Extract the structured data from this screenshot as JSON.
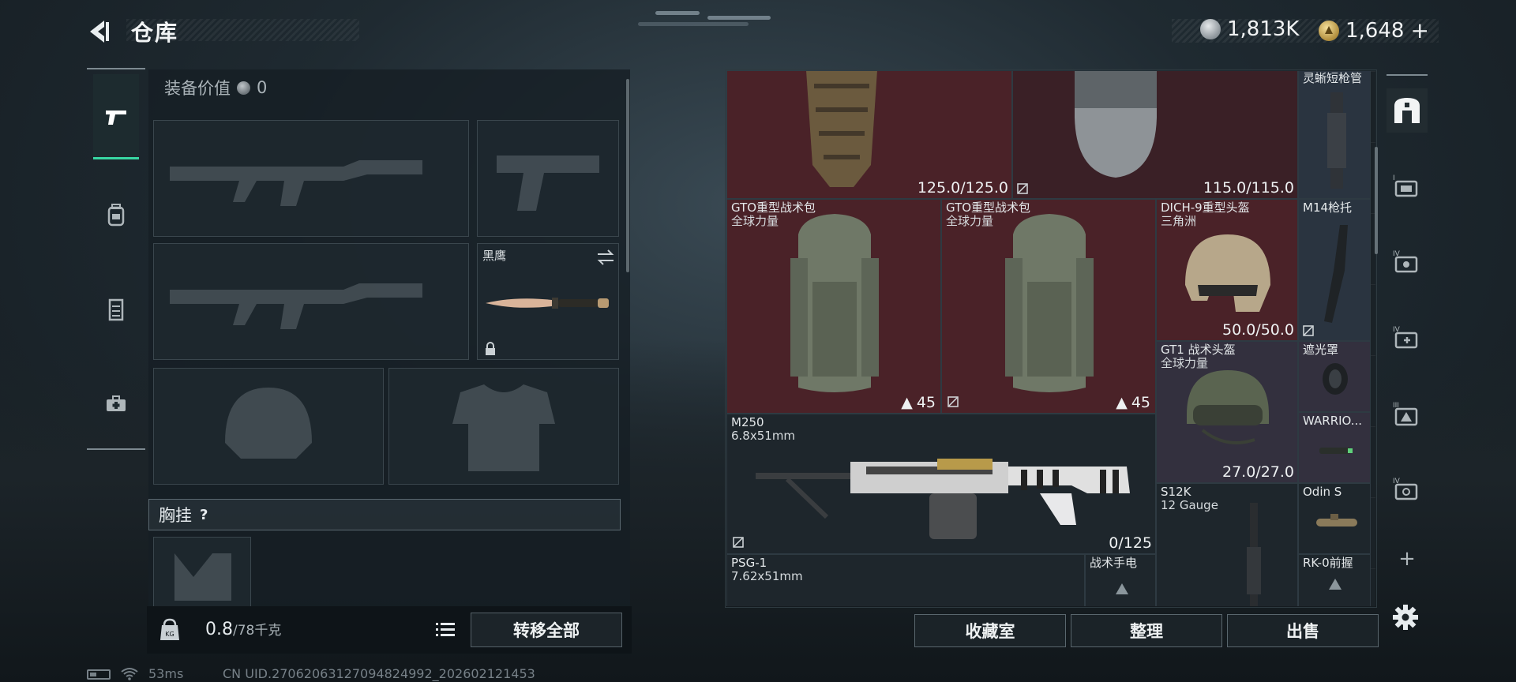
{
  "header": {
    "title": "仓库",
    "currency_silver": "1,813K",
    "currency_gold": "1,648",
    "currency_add": "+"
  },
  "left_rail": {
    "tabs": [
      {
        "icon": "pistol-icon",
        "active": true
      },
      {
        "icon": "backpack-icon",
        "active": false
      },
      {
        "icon": "vest-icon",
        "active": false
      },
      {
        "icon": "medkit-icon",
        "active": false
      }
    ]
  },
  "equipment": {
    "value_label": "装备价值",
    "value": "0",
    "knife_name": "黑鹰",
    "chest_rig_label": "胸挂",
    "chest_rig_help": "?",
    "weight_current": "0.8",
    "weight_max": "/78千克",
    "weight_icon_text": "KG",
    "transfer_all": "转移全部"
  },
  "stash": {
    "items": [
      {
        "id": "top-left",
        "name": "",
        "value": "125.0/125.0"
      },
      {
        "id": "top-mid",
        "name": "",
        "value": "115.0/115.0"
      },
      {
        "id": "lynx-barrel",
        "name": "灵蜥短枪管"
      },
      {
        "id": "gto1",
        "name": "GTO重型战术包",
        "sub": "全球力量",
        "capacity": "45"
      },
      {
        "id": "gto2",
        "name": "GTO重型战术包",
        "sub": "全球力量",
        "capacity": "45"
      },
      {
        "id": "dich9",
        "name": "DICH-9重型头盔",
        "sub": "三角洲",
        "value": "50.0/50.0"
      },
      {
        "id": "m14-stock",
        "name": "M14枪托"
      },
      {
        "id": "gt1",
        "name": "GT1 战术头盔",
        "sub": "全球力量",
        "value": "27.0/27.0"
      },
      {
        "id": "shade",
        "name": "遮光罩"
      },
      {
        "id": "m250",
        "name": "M250",
        "sub": "6.8x51mm",
        "value": "0/125"
      },
      {
        "id": "warrior",
        "name": "WARRIO..."
      },
      {
        "id": "s12k",
        "name": "S12K",
        "sub": "12 Gauge"
      },
      {
        "id": "odin",
        "name": "Odin S"
      },
      {
        "id": "psg1",
        "name": "PSG-1",
        "sub": "7.62x51mm"
      },
      {
        "id": "flashlight",
        "name": "战术手电"
      },
      {
        "id": "rk0",
        "name": "RK-0前握"
      }
    ]
  },
  "right_rail": {
    "buttons": [
      {
        "icon": "safehouse-icon",
        "level": ""
      },
      {
        "icon": "filter-a-icon",
        "level": "I"
      },
      {
        "icon": "filter-b-icon",
        "level": "IV"
      },
      {
        "icon": "filter-c-icon",
        "level": "IV"
      },
      {
        "icon": "filter-d-icon",
        "level": "III"
      },
      {
        "icon": "filter-e-icon",
        "level": "IV"
      }
    ],
    "add": "+"
  },
  "actions": {
    "collection": "收藏室",
    "organize": "整理",
    "sell": "出售"
  },
  "status": {
    "ping": "53ms",
    "uid": "CN UID.27062063127094824992_202602121453"
  },
  "colors": {
    "accent": "#38d7a2",
    "high_tier_bg": "#4a2228",
    "mid_tier_bg": "#33303e",
    "low_tier_bg": "#2a3440"
  }
}
